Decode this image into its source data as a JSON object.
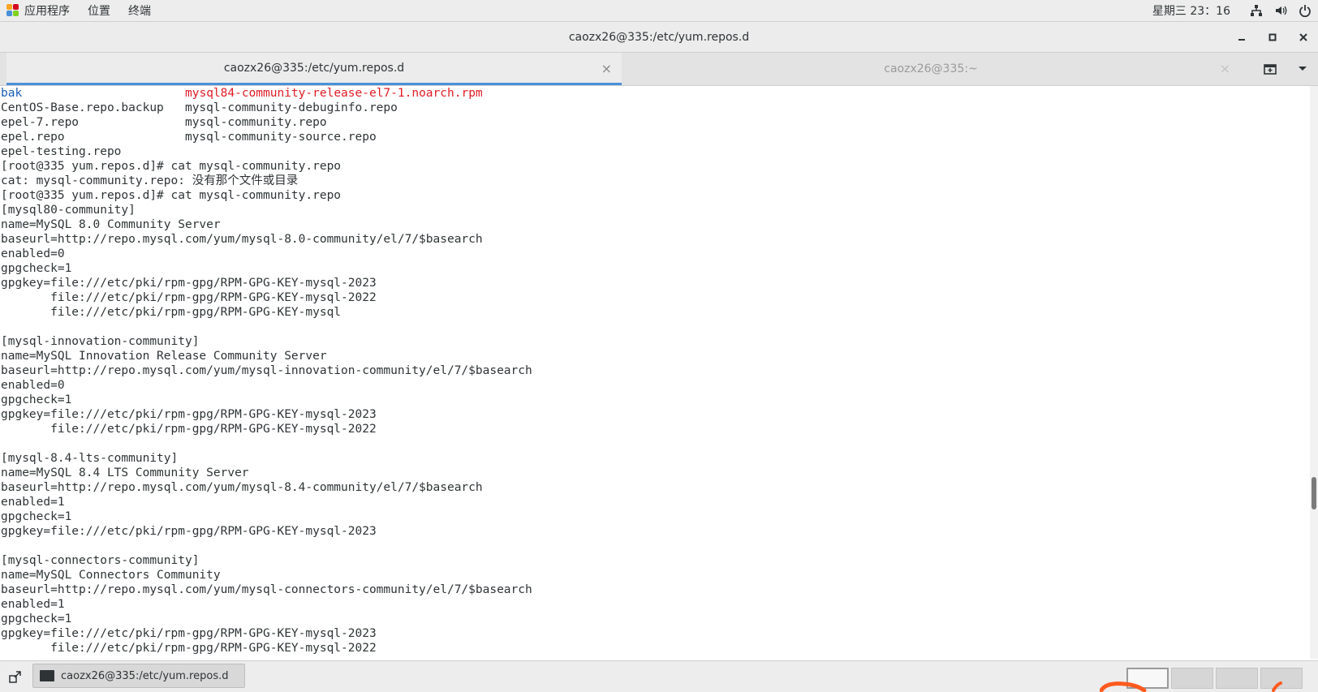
{
  "top_panel": {
    "apps_label": "应用程序",
    "places_label": "位置",
    "terminal_label": "终端",
    "clock": "星期三 23：16"
  },
  "window": {
    "title": "caozx26@335:/etc/yum.repos.d"
  },
  "tabs": [
    {
      "label": "caozx26@335:/etc/yum.repos.d",
      "active": true
    },
    {
      "label": "caozx26@335:~",
      "active": false
    }
  ],
  "terminal": {
    "lines": [
      {
        "segments": [
          {
            "text": "bak",
            "color": "#1a5fb4"
          },
          {
            "text": "                       ",
            "color": ""
          },
          {
            "text": "mysql84-community-release-el7-1.noarch.rpm",
            "color": "#e01b24"
          }
        ]
      },
      {
        "segments": [
          {
            "text": "CentOS-Base.repo.backup   mysql-community-debuginfo.repo",
            "color": ""
          }
        ]
      },
      {
        "segments": [
          {
            "text": "epel-7.repo               mysql-community.repo",
            "color": ""
          }
        ]
      },
      {
        "segments": [
          {
            "text": "epel.repo                 mysql-community-source.repo",
            "color": ""
          }
        ]
      },
      {
        "segments": [
          {
            "text": "epel-testing.repo",
            "color": ""
          }
        ]
      },
      {
        "segments": [
          {
            "text": "[root@335 yum.repos.d]# cat mysql-community.repo",
            "color": ""
          }
        ]
      },
      {
        "segments": [
          {
            "text": "cat: mysql-community.repo: 没有那个文件或目录",
            "color": ""
          }
        ]
      },
      {
        "segments": [
          {
            "text": "[root@335 yum.repos.d]# cat mysql-community.repo",
            "color": ""
          }
        ]
      },
      {
        "segments": [
          {
            "text": "[mysql80-community]",
            "color": ""
          }
        ]
      },
      {
        "segments": [
          {
            "text": "name=MySQL 8.0 Community Server",
            "color": ""
          }
        ]
      },
      {
        "segments": [
          {
            "text": "baseurl=http://repo.mysql.com/yum/mysql-8.0-community/el/7/$basearch",
            "color": ""
          }
        ]
      },
      {
        "segments": [
          {
            "text": "enabled=0",
            "color": ""
          }
        ]
      },
      {
        "segments": [
          {
            "text": "gpgcheck=1",
            "color": ""
          }
        ]
      },
      {
        "segments": [
          {
            "text": "gpgkey=file:///etc/pki/rpm-gpg/RPM-GPG-KEY-mysql-2023",
            "color": ""
          }
        ]
      },
      {
        "segments": [
          {
            "text": "       file:///etc/pki/rpm-gpg/RPM-GPG-KEY-mysql-2022",
            "color": ""
          }
        ]
      },
      {
        "segments": [
          {
            "text": "       file:///etc/pki/rpm-gpg/RPM-GPG-KEY-mysql",
            "color": ""
          }
        ]
      },
      {
        "segments": [
          {
            "text": "",
            "color": ""
          }
        ]
      },
      {
        "segments": [
          {
            "text": "[mysql-innovation-community]",
            "color": ""
          }
        ]
      },
      {
        "segments": [
          {
            "text": "name=MySQL Innovation Release Community Server",
            "color": ""
          }
        ]
      },
      {
        "segments": [
          {
            "text": "baseurl=http://repo.mysql.com/yum/mysql-innovation-community/el/7/$basearch",
            "color": ""
          }
        ]
      },
      {
        "segments": [
          {
            "text": "enabled=0",
            "color": ""
          }
        ]
      },
      {
        "segments": [
          {
            "text": "gpgcheck=1",
            "color": ""
          }
        ]
      },
      {
        "segments": [
          {
            "text": "gpgkey=file:///etc/pki/rpm-gpg/RPM-GPG-KEY-mysql-2023",
            "color": ""
          }
        ]
      },
      {
        "segments": [
          {
            "text": "       file:///etc/pki/rpm-gpg/RPM-GPG-KEY-mysql-2022",
            "color": ""
          }
        ]
      },
      {
        "segments": [
          {
            "text": "",
            "color": ""
          }
        ]
      },
      {
        "segments": [
          {
            "text": "[mysql-8.4-lts-community]",
            "color": ""
          }
        ]
      },
      {
        "segments": [
          {
            "text": "name=MySQL 8.4 LTS Community Server",
            "color": ""
          }
        ]
      },
      {
        "segments": [
          {
            "text": "baseurl=http://repo.mysql.com/yum/mysql-8.4-community/el/7/$basearch",
            "color": ""
          }
        ]
      },
      {
        "segments": [
          {
            "text": "enabled=1",
            "color": ""
          }
        ]
      },
      {
        "segments": [
          {
            "text": "gpgcheck=1",
            "color": ""
          }
        ]
      },
      {
        "segments": [
          {
            "text": "gpgkey=file:///etc/pki/rpm-gpg/RPM-GPG-KEY-mysql-2023",
            "color": ""
          }
        ]
      },
      {
        "segments": [
          {
            "text": "",
            "color": ""
          }
        ]
      },
      {
        "segments": [
          {
            "text": "[mysql-connectors-community]",
            "color": ""
          }
        ]
      },
      {
        "segments": [
          {
            "text": "name=MySQL Connectors Community",
            "color": ""
          }
        ]
      },
      {
        "segments": [
          {
            "text": "baseurl=http://repo.mysql.com/yum/mysql-connectors-community/el/7/$basearch",
            "color": ""
          }
        ]
      },
      {
        "segments": [
          {
            "text": "enabled=1",
            "color": ""
          }
        ]
      },
      {
        "segments": [
          {
            "text": "gpgcheck=1",
            "color": ""
          }
        ]
      },
      {
        "segments": [
          {
            "text": "gpgkey=file:///etc/pki/rpm-gpg/RPM-GPG-KEY-mysql-2023",
            "color": ""
          }
        ]
      },
      {
        "segments": [
          {
            "text": "       file:///etc/pki/rpm-gpg/RPM-GPG-KEY-mysql-2022",
            "color": ""
          }
        ]
      }
    ]
  },
  "taskbar": {
    "task_label": "caozx26@335:/etc/yum.repos.d",
    "workspaces": 4,
    "active_workspace": 1
  },
  "icons": {
    "apps": "apps-icon",
    "network": "network-icon",
    "volume": "volume-icon",
    "power": "power-icon",
    "minimize": "minimize-icon",
    "maximize": "maximize-icon",
    "close": "close-icon",
    "new_tab": "new-tab-icon",
    "tab_menu": "chevron-down-icon",
    "show_desktop": "show-desktop-icon",
    "terminal": "terminal-icon"
  },
  "colors": {
    "tab_accent": "#4a90d9",
    "directory": "#1a5fb4",
    "rpm_file": "#e01b24",
    "annotation": "#ff5a1f"
  }
}
